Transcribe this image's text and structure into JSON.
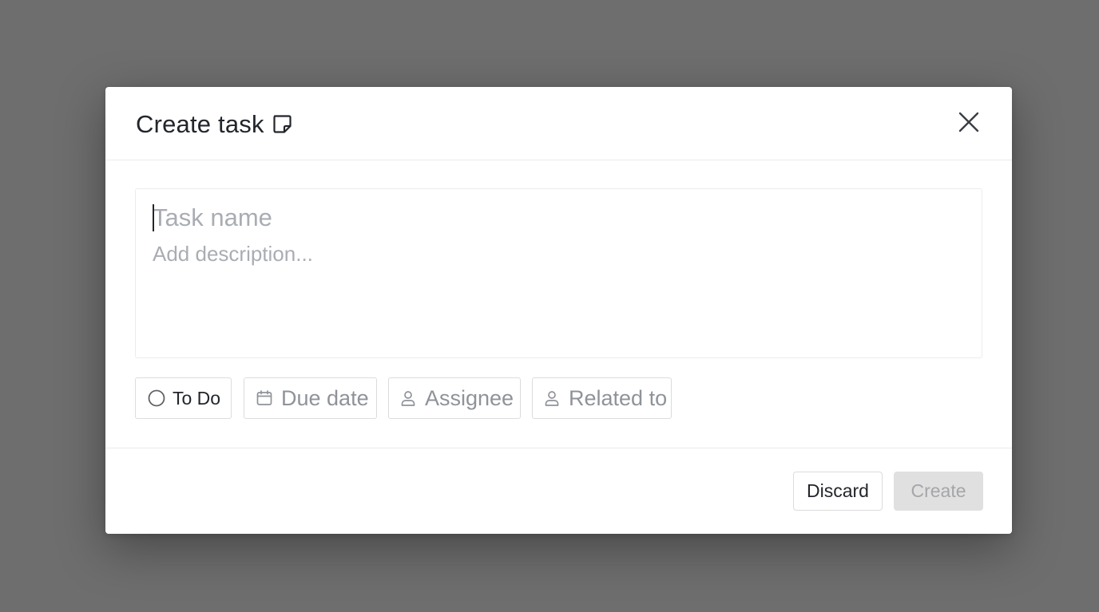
{
  "dialog": {
    "title": "Create task",
    "title_icon": "note-icon",
    "close_icon": "close-icon"
  },
  "editor": {
    "name_value": "",
    "name_placeholder": "Task name",
    "description_value": "",
    "description_placeholder": "Add description..."
  },
  "chips": {
    "status": {
      "label": "To Do",
      "icon": "circle-status-icon"
    },
    "due_date": {
      "label": "Due date",
      "icon": "calendar-icon"
    },
    "assignee": {
      "label": "Assignee",
      "icon": "person-icon"
    },
    "related": {
      "label": "Related to",
      "icon": "person-icon"
    }
  },
  "footer": {
    "discard_label": "Discard",
    "create_label": "Create"
  },
  "colors": {
    "backdrop": "#6e6e6e",
    "surface": "#ffffff",
    "text": "#22262b",
    "muted": "#a9adb3",
    "border": "#dcdcdc",
    "disabled_bg": "#e0e0e0"
  }
}
